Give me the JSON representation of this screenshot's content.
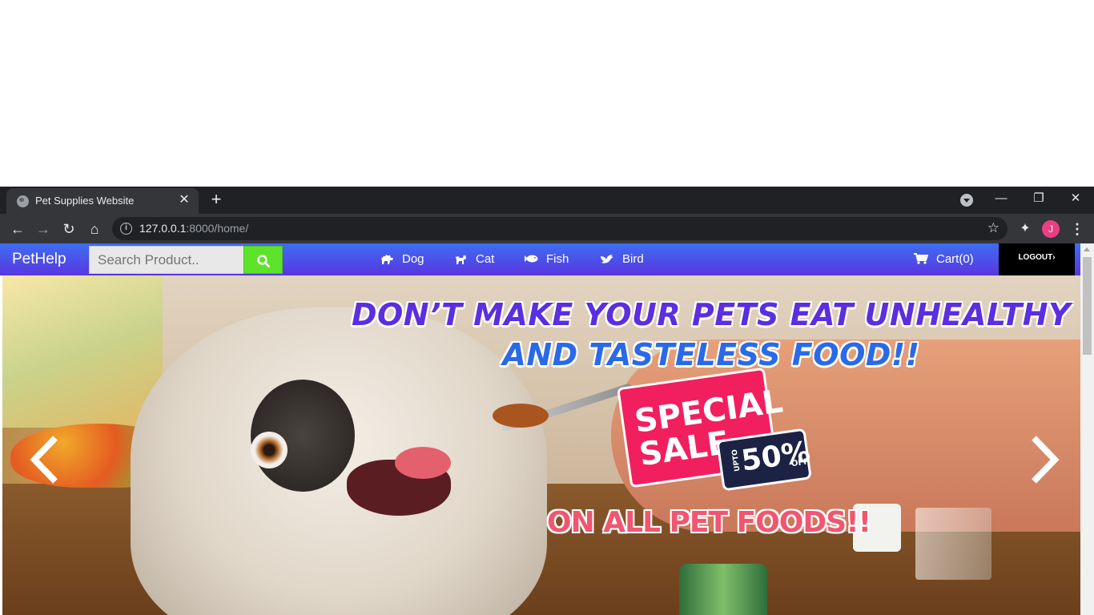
{
  "browser": {
    "tab_title": "Pet Supplies Website",
    "url_host": "127.0.0.1",
    "url_rest": ":8000/home/",
    "profile_initial": "J"
  },
  "navbar": {
    "brand": "PetHelp",
    "search_placeholder": "Search Product..",
    "links": {
      "dog": "Dog",
      "cat": "Cat",
      "fish": "Fish",
      "bird": "Bird"
    },
    "cart_label": "Cart(0)",
    "logout_label": "LOGOUT"
  },
  "banner": {
    "headline_line1": "DON’T MAKE YOUR PETS EAT UNHEALTHY",
    "headline_line2": "AND TASTELESS FOOD!!",
    "sale_line1": "SPECIAL",
    "sale_line2": "SALE",
    "upto": "UPTO",
    "percent": "50%",
    "off": "OFF",
    "subline": "ON ALL PET FOODS!!"
  },
  "colors": {
    "navbar_top": "#3d6ef2",
    "navbar_bottom": "#5a35e0",
    "search_button": "#5ee32b",
    "logout_bg": "#000000",
    "headline_purple": "#5b2ee0",
    "sale_pink": "#f21f5f"
  },
  "icons": {
    "search": "magnifier-icon",
    "dog": "dog-icon",
    "cat": "cat-icon",
    "fish": "fish-icon",
    "bird": "bird-icon",
    "cart": "cart-icon",
    "prev": "chevron-left-icon",
    "next": "chevron-right-icon"
  }
}
